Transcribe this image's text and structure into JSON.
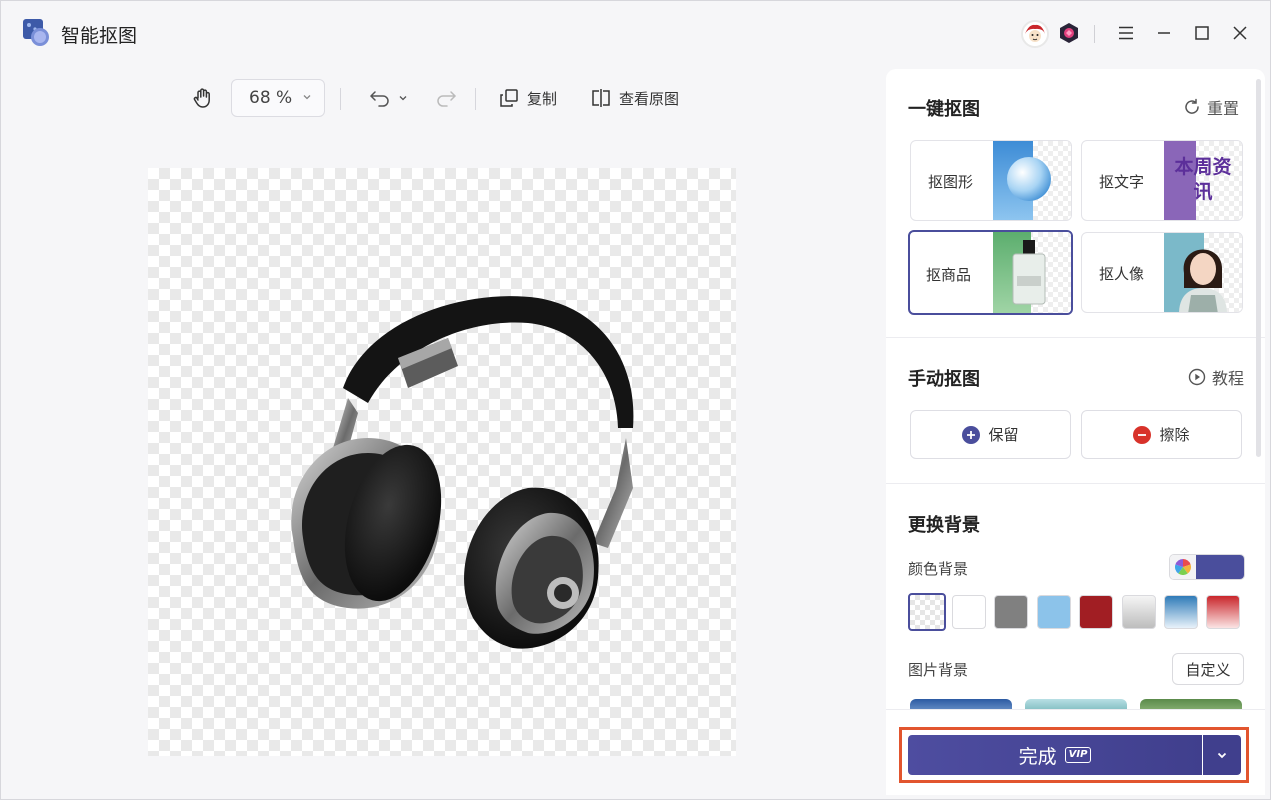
{
  "app": {
    "title": "智能抠图"
  },
  "toolbar": {
    "zoom_value": "68 %",
    "copy_label": "复制",
    "view_original_label": "查看原图"
  },
  "panel": {
    "auto_section": {
      "title": "一键抠图",
      "reset_label": "重置",
      "cards": [
        {
          "label": "抠图形",
          "thumb_text": ""
        },
        {
          "label": "抠文字",
          "thumb_text": "本周资讯"
        },
        {
          "label": "抠商品",
          "thumb_text": ""
        },
        {
          "label": "抠人像",
          "thumb_text": ""
        }
      ],
      "active_card": "抠商品"
    },
    "manual_section": {
      "title": "手动抠图",
      "tutorial_label": "教程",
      "keep_label": "保留",
      "erase_label": "擦除"
    },
    "background_section": {
      "title": "更换背景",
      "color_label": "颜色背景",
      "current_color": "#4a4e9c",
      "swatches": [
        "transparent",
        "#ffffff",
        "#808080",
        "#8cc3ea",
        "#a11e23",
        "gradient-gray",
        "gradient-blue",
        "gradient-red"
      ],
      "image_label": "图片背景",
      "custom_label": "自定义"
    }
  },
  "footer": {
    "done_label": "完成",
    "vip_label": "VIP",
    "accent_color": "#4a4e9c",
    "highlight_color": "#e2552e"
  }
}
